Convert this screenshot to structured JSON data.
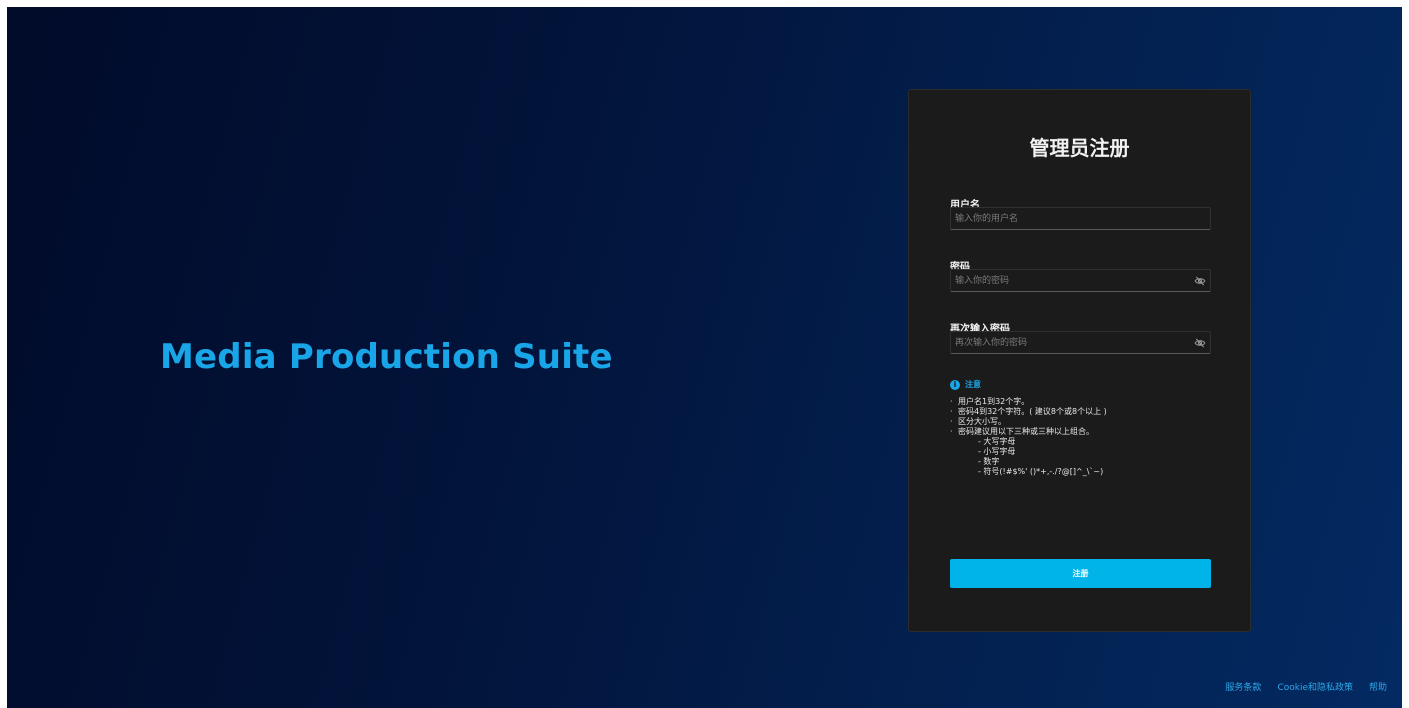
{
  "brand": {
    "name": "Media Production Suite"
  },
  "form": {
    "title": "管理员注册",
    "username": {
      "label": "用户名",
      "placeholder": "输入你的用户名"
    },
    "password": {
      "label": "密码",
      "placeholder": "输入你的密码",
      "toggle_icon": "eye-off-icon"
    },
    "confirm": {
      "label": "再次输入密码",
      "placeholder": "再次输入你的密码",
      "toggle_icon": "eye-off-icon"
    },
    "note": {
      "icon": "info-icon",
      "icon_glyph": "i",
      "title": "注意",
      "items": [
        "用户名1到32个字。",
        "密码4到32个字符。( 建议8个或8个以上 )",
        "区分大小写。",
        "密码建议用以下三种或三种以上组合。"
      ],
      "sub_items": [
        "- 大写字母",
        "- 小写字母",
        "- 数字",
        "- 符号(!#$%' ()*+,-./?@[]^_\\`~)"
      ]
    },
    "submit_label": "注册"
  },
  "footer": {
    "links": [
      "服务条款",
      "Cookie和隐私政策",
      "帮助"
    ]
  },
  "colors": {
    "accent": "#00b4ea",
    "brand_text": "#19a6e8",
    "card_bg": "#1b1b1b"
  }
}
